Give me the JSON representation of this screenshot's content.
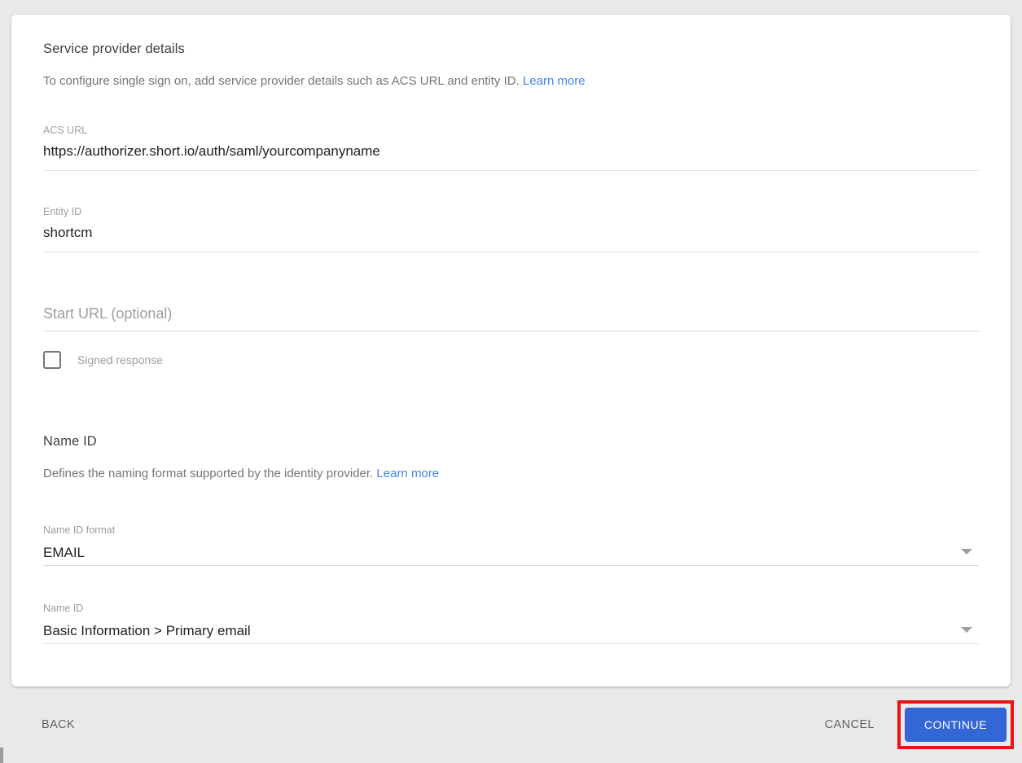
{
  "service_provider_section": {
    "title": "Service provider details",
    "description": "To configure single sign on, add service provider details such as ACS URL and entity ID.",
    "learn_more_label": "Learn more"
  },
  "fields": {
    "acs_url": {
      "label": "ACS URL",
      "value": "https://authorizer.short.io/auth/saml/yourcompanyname"
    },
    "entity_id": {
      "label": "Entity ID",
      "value": "shortcm"
    },
    "start_url": {
      "placeholder": "Start URL (optional)",
      "value": ""
    },
    "signed_response": {
      "label": "Signed response",
      "checked": false
    }
  },
  "name_id_section": {
    "title": "Name ID",
    "description": "Defines the naming format supported by the identity provider.",
    "learn_more_label": "Learn more",
    "name_id_format": {
      "label": "Name ID format",
      "value": "EMAIL"
    },
    "name_id": {
      "label": "Name ID",
      "value": "Basic Information > Primary email"
    }
  },
  "footer": {
    "back_label": "BACK",
    "cancel_label": "CANCEL",
    "continue_label": "CONTINUE"
  },
  "colors": {
    "page_background": "#e9e9e9",
    "card_background": "#ffffff",
    "link_blue": "#4285f4",
    "continue_button_blue": "#3367d6",
    "annotation_red": "#ec1313"
  },
  "annotation": {
    "type": "highlight-rectangle",
    "color": "#ec1313",
    "target": "continue-button"
  }
}
